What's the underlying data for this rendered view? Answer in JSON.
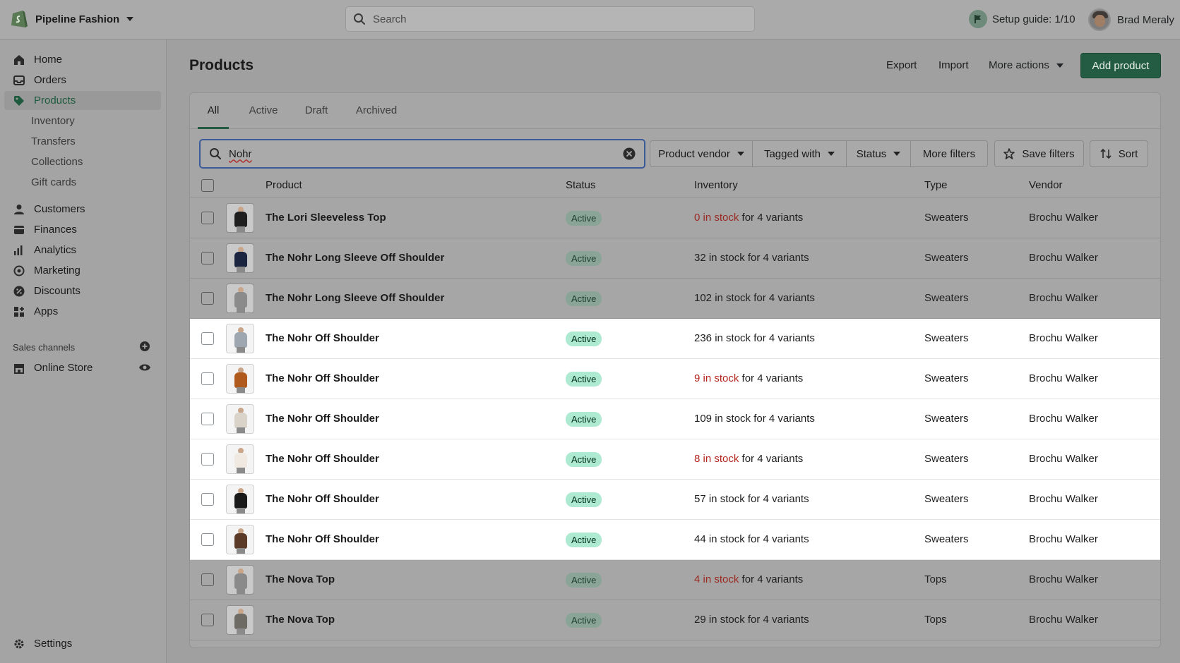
{
  "topbar": {
    "store_name": "Pipeline Fashion",
    "search_placeholder": "Search",
    "setup_guide": "Setup guide: 1/10",
    "user_name": "Brad Meraly"
  },
  "sidebar": {
    "items": [
      {
        "label": "Home",
        "icon": "home-icon"
      },
      {
        "label": "Orders",
        "icon": "orders-icon"
      },
      {
        "label": "Products",
        "icon": "tag-icon",
        "active": true
      },
      {
        "label": "Customers",
        "icon": "person-icon"
      },
      {
        "label": "Finances",
        "icon": "finances-icon"
      },
      {
        "label": "Analytics",
        "icon": "bar-chart-icon"
      },
      {
        "label": "Marketing",
        "icon": "target-icon"
      },
      {
        "label": "Discounts",
        "icon": "discount-icon"
      },
      {
        "label": "Apps",
        "icon": "apps-icon"
      }
    ],
    "product_subitems": [
      "Inventory",
      "Transfers",
      "Collections",
      "Gift cards"
    ],
    "sales_channels_label": "Sales channels",
    "online_store": "Online Store",
    "settings": "Settings"
  },
  "header": {
    "title": "Products",
    "export": "Export",
    "import": "Import",
    "more_actions": "More actions",
    "add_product": "Add product"
  },
  "tabs": [
    "All",
    "Active",
    "Draft",
    "Archived"
  ],
  "filters": {
    "search_value": "Nohr",
    "product_vendor": "Product vendor",
    "tagged_with": "Tagged with",
    "status": "Status",
    "more_filters": "More filters",
    "save_filters": "Save filters",
    "sort": "Sort"
  },
  "table": {
    "columns": [
      "Product",
      "Status",
      "Inventory",
      "Type",
      "Vendor"
    ],
    "rows": [
      {
        "name": "The Lori Sleeveless Top",
        "status": "Active",
        "stock": "0 in stock",
        "variants": " for 4 variants",
        "low": true,
        "type": "Sweaters",
        "vendor": "Brochu Walker",
        "highlight": false,
        "color": "#1f1f1f"
      },
      {
        "name": "The Nohr Long Sleeve Off Shoulder",
        "status": "Active",
        "stock": "32 in stock",
        "variants": " for 4 variants",
        "low": false,
        "type": "Sweaters",
        "vendor": "Brochu Walker",
        "highlight": false,
        "color": "#1c2540"
      },
      {
        "name": "The Nohr Long Sleeve Off Shoulder",
        "status": "Active",
        "stock": "102 in stock",
        "variants": " for 4 variants",
        "low": false,
        "type": "Sweaters",
        "vendor": "Brochu Walker",
        "highlight": false,
        "color": "#8b8b8b"
      },
      {
        "name": "The Nohr Off Shoulder",
        "status": "Active",
        "stock": "236 in stock",
        "variants": " for 4 variants",
        "low": false,
        "type": "Sweaters",
        "vendor": "Brochu Walker",
        "highlight": true,
        "color": "#9ea6b0"
      },
      {
        "name": "The Nohr Off Shoulder",
        "status": "Active",
        "stock": "9 in stock",
        "variants": " for 4 variants",
        "low": true,
        "type": "Sweaters",
        "vendor": "Brochu Walker",
        "highlight": true,
        "color": "#b05a1e"
      },
      {
        "name": "The Nohr Off Shoulder",
        "status": "Active",
        "stock": "109 in stock",
        "variants": " for 4 variants",
        "low": false,
        "type": "Sweaters",
        "vendor": "Brochu Walker",
        "highlight": true,
        "color": "#d9d3c9"
      },
      {
        "name": "The Nohr Off Shoulder",
        "status": "Active",
        "stock": "8 in stock",
        "variants": " for 4 variants",
        "low": true,
        "type": "Sweaters",
        "vendor": "Brochu Walker",
        "highlight": true,
        "color": "#efe9e2"
      },
      {
        "name": "The Nohr Off Shoulder",
        "status": "Active",
        "stock": "57 in stock",
        "variants": " for 4 variants",
        "low": false,
        "type": "Sweaters",
        "vendor": "Brochu Walker",
        "highlight": true,
        "color": "#1a1a1a"
      },
      {
        "name": "The Nohr Off Shoulder",
        "status": "Active",
        "stock": "44 in stock",
        "variants": " for 4 variants",
        "low": false,
        "type": "Sweaters",
        "vendor": "Brochu Walker",
        "highlight": true,
        "color": "#5b3a28"
      },
      {
        "name": "The Nova Top",
        "status": "Active",
        "stock": "4 in stock",
        "variants": " for 4 variants",
        "low": true,
        "type": "Tops",
        "vendor": "Brochu Walker",
        "highlight": false,
        "color": "#8a8a8a"
      },
      {
        "name": "The Nova Top",
        "status": "Active",
        "stock": "29 in stock",
        "variants": " for 4 variants",
        "low": false,
        "type": "Tops",
        "vendor": "Brochu Walker",
        "highlight": false,
        "color": "#6e6a64"
      }
    ]
  },
  "colors": {
    "brand_green": "#245c43",
    "low_stock_red": "#b3261e",
    "badge_green": "#aee9d1"
  }
}
